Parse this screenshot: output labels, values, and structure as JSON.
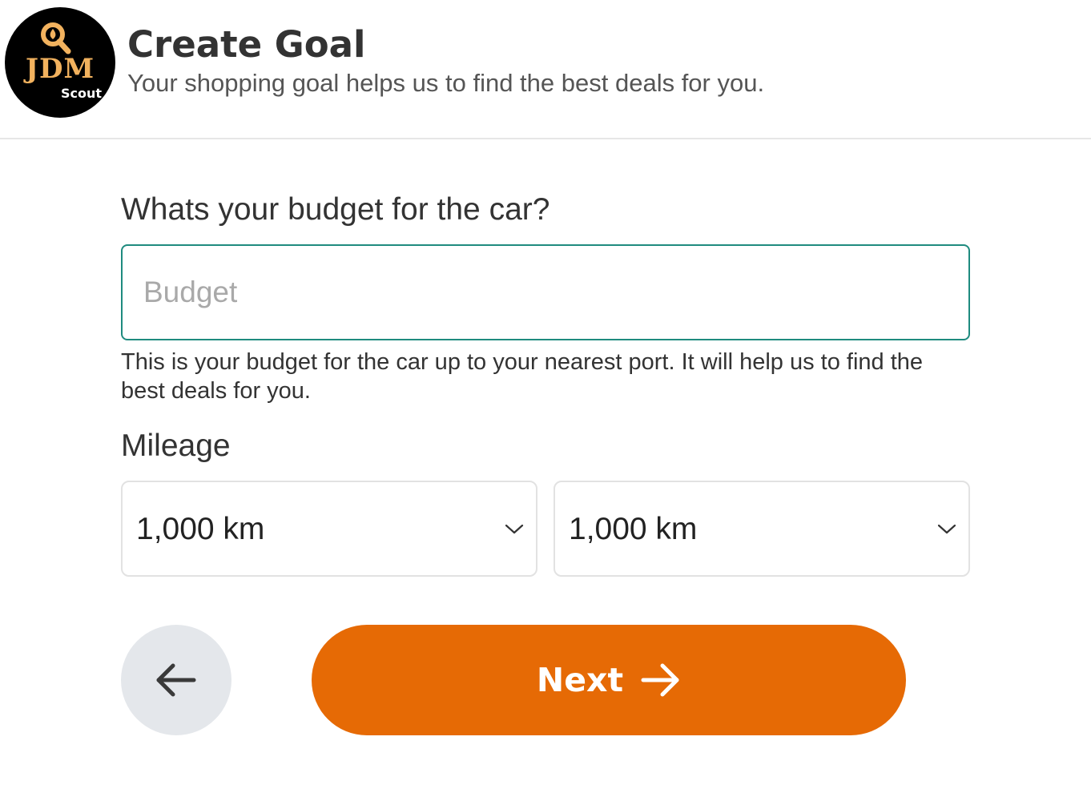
{
  "header": {
    "logo": {
      "brand_text": "JDM",
      "sub_text": "Scout",
      "icon": "magnifier-icon"
    },
    "title": "Create Goal",
    "subtitle": "Your shopping goal helps us to find the best deals for you."
  },
  "form": {
    "budget_question": "Whats your budget for the car?",
    "budget_input": {
      "value": "",
      "placeholder": "Budget"
    },
    "budget_help": "This is your budget for the car up to your nearest port. It will help us to find the best deals for you.",
    "mileage_label": "Mileage",
    "mileage_min": {
      "value": "1,000 km",
      "icon": "chevron-down-icon"
    },
    "mileage_max": {
      "value": "1,000 km",
      "icon": "chevron-down-icon"
    }
  },
  "actions": {
    "back_icon": "arrow-left-icon",
    "next_label": "Next",
    "next_icon": "arrow-right-icon"
  },
  "colors": {
    "accent": "#e66a05",
    "input_focus_border": "#1f8b7f",
    "logo_gold": "#f2b25e",
    "back_button_bg": "#e4e7eb"
  }
}
